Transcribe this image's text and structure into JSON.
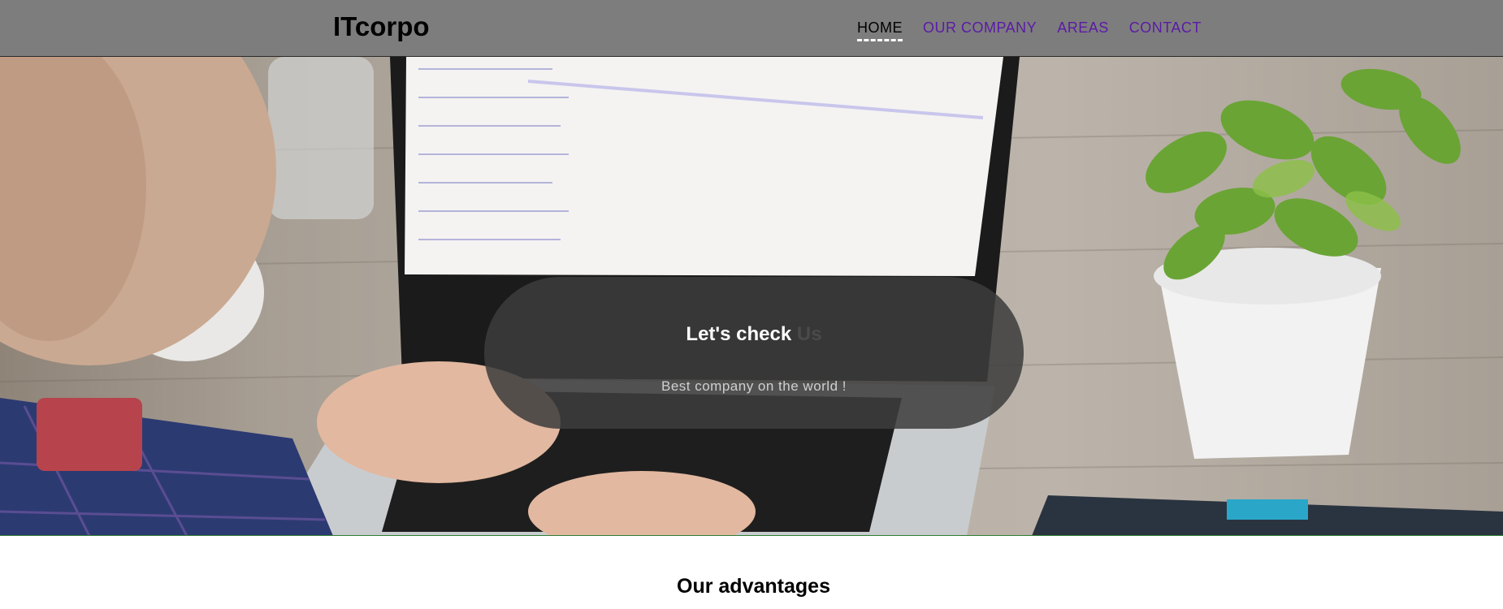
{
  "header": {
    "logo": "ITcorpo",
    "nav": [
      {
        "label": "HOME",
        "active": true
      },
      {
        "label": "OUR COMPANY",
        "active": false
      },
      {
        "label": "AREAS",
        "active": false
      },
      {
        "label": "CONTACT",
        "active": false
      }
    ]
  },
  "hero": {
    "title_main": "Let's check",
    "title_accent": "Us",
    "subtitle": "Best company on the world !"
  },
  "advantages": {
    "title": "Our advantages"
  },
  "colors": {
    "header_bg": "#7d7d7d",
    "nav_link": "#5b1aa8",
    "nav_active": "#000000",
    "overlay_bg": "#3c3c3c"
  },
  "icons": [
    "hero-photo-laptop",
    "hero-photo-plant"
  ]
}
